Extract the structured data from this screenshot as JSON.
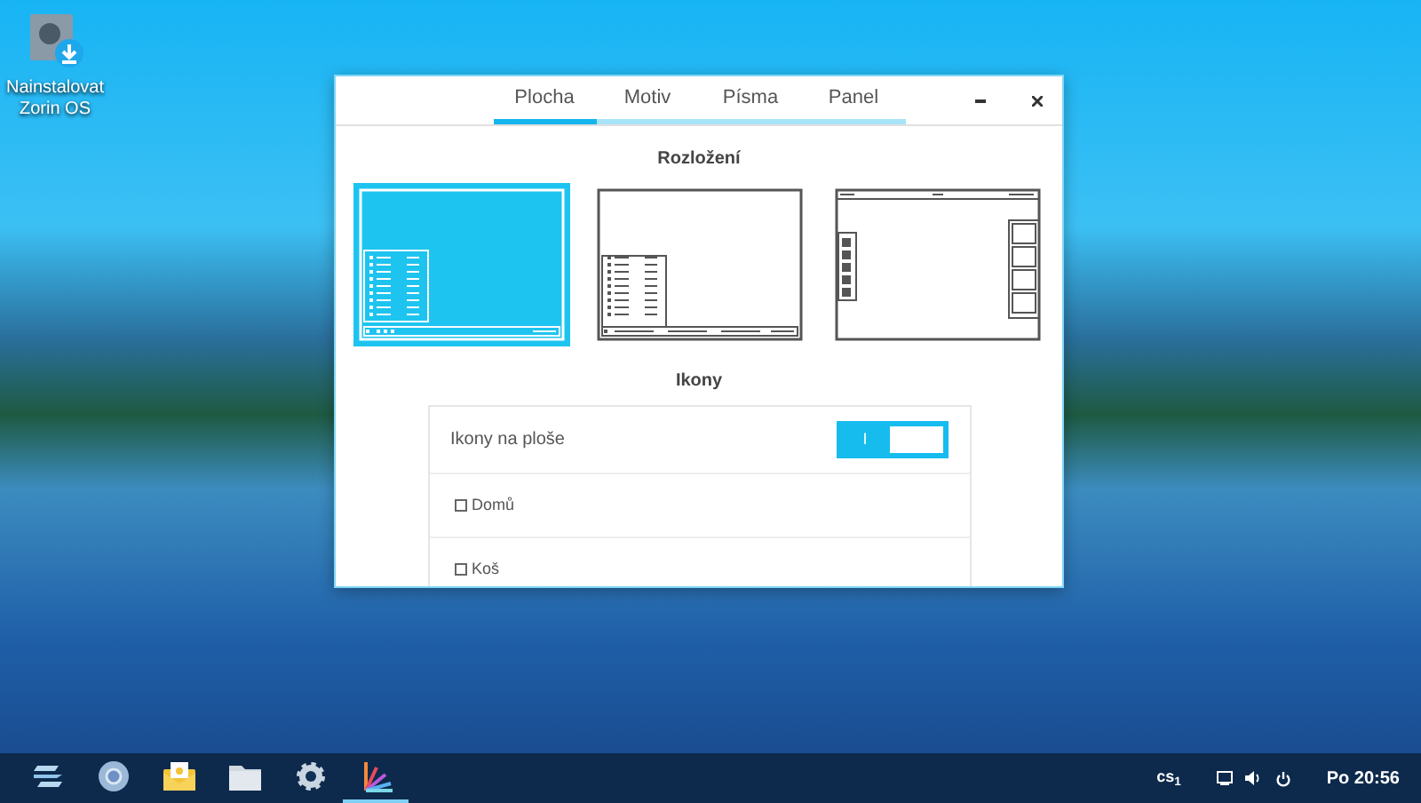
{
  "desktop_icons": [
    {
      "label": "Nainstalovat Zorin OS"
    }
  ],
  "window": {
    "tabs": [
      {
        "label": "Plocha",
        "selected": true
      },
      {
        "label": "Motiv",
        "selected": false
      },
      {
        "label": "Písma",
        "selected": false
      },
      {
        "label": "Panel",
        "selected": false
      }
    ],
    "layout_section": {
      "title": "Rozložení",
      "options": [
        {
          "kind": "windows",
          "selected": true
        },
        {
          "kind": "classic",
          "selected": false
        },
        {
          "kind": "dock",
          "selected": false
        }
      ]
    },
    "icons_section": {
      "title": "Ikony",
      "rows": [
        {
          "kind": "switch",
          "label": "Ikony na ploše",
          "on": true,
          "switch_text": "I"
        },
        {
          "kind": "checkbox",
          "label": "Domů",
          "checked": false
        },
        {
          "kind": "checkbox",
          "label": "Koš",
          "checked": false
        }
      ]
    }
  },
  "taskbar": {
    "apps": [
      {
        "kind": "zorin",
        "selected": false
      },
      {
        "kind": "browser",
        "selected": false
      },
      {
        "kind": "mail",
        "selected": false
      },
      {
        "kind": "files",
        "selected": false
      },
      {
        "kind": "settings",
        "selected": false
      },
      {
        "kind": "tweak",
        "selected": true
      }
    ],
    "keyboard": "cs$_{1}$",
    "clock": "Po 20:56"
  }
}
